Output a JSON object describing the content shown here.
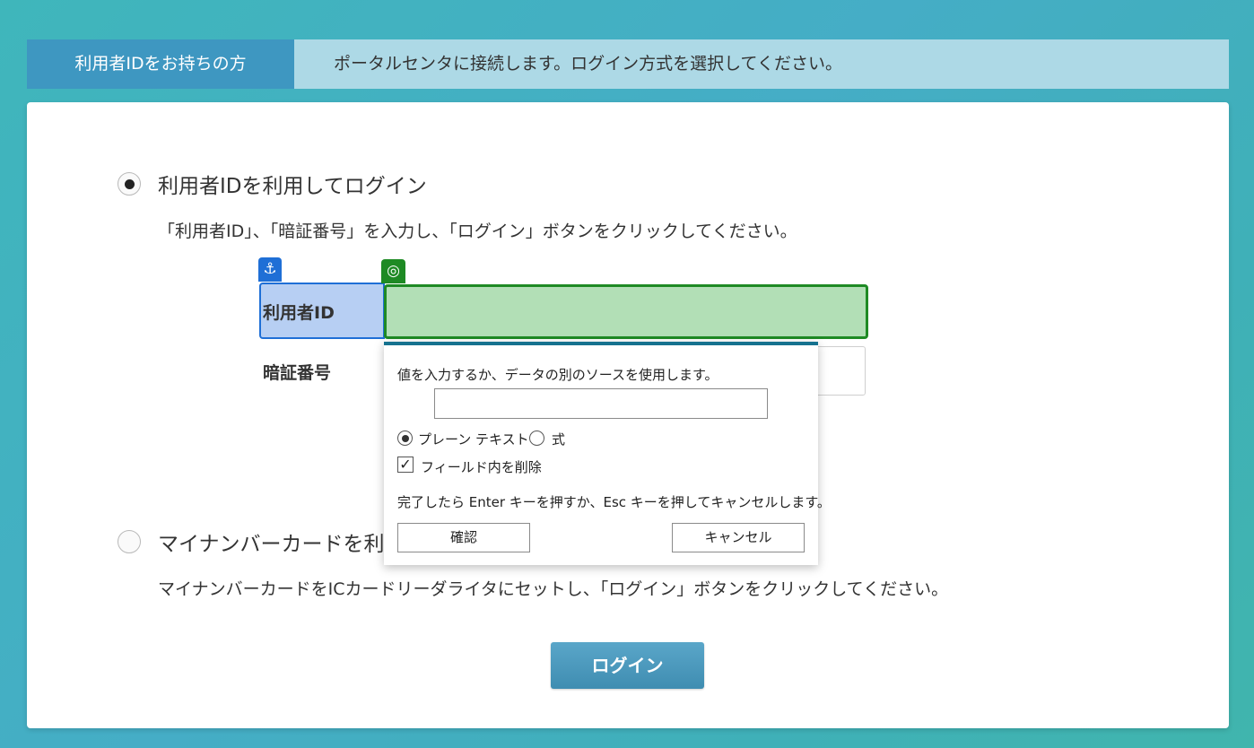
{
  "header": {
    "tab_label": "利用者IDをお持ちの方",
    "description": "ポータルセンタに接続します。ログイン方式を選択してください。"
  },
  "option_id": {
    "title": "利用者IDを利用してログイン",
    "description": "「利用者ID」、「暗証番号」を入力し、「ログイン」ボタンをクリックしてください。",
    "selected": true
  },
  "form": {
    "user_id_label": "利用者ID",
    "pin_label": "暗証番号"
  },
  "option_card": {
    "title": "マイナンバーカードを利",
    "description": "マイナンバーカードをICカードリーダライタにセットし、「ログイン」ボタンをクリックしてください。",
    "selected": false
  },
  "login_button": {
    "label": "ログイン"
  },
  "overlay_icons": {
    "anchor": "anchor-icon",
    "target": "target-icon"
  },
  "popup": {
    "prompt": "値を入力するか、データの別のソースを使用します。",
    "value": "",
    "radio_plain_label": "プレーン テキスト",
    "radio_expression_label": "式",
    "selected_mode": "プレーン テキスト",
    "checkbox_label": "フィールド内を削除",
    "checkbox_checked": true,
    "hint": "完了したら Enter キーを押すか、Esc キーを押してキャンセルします。",
    "confirm_label": "確認",
    "cancel_label": "キャンセル"
  },
  "colors": {
    "header_tab": "#3e97c1",
    "header_bar": "#add9e6",
    "anchor_highlight": "#1f6fd6",
    "target_highlight": "#1e8a24",
    "login_button": "#4a98bc"
  }
}
